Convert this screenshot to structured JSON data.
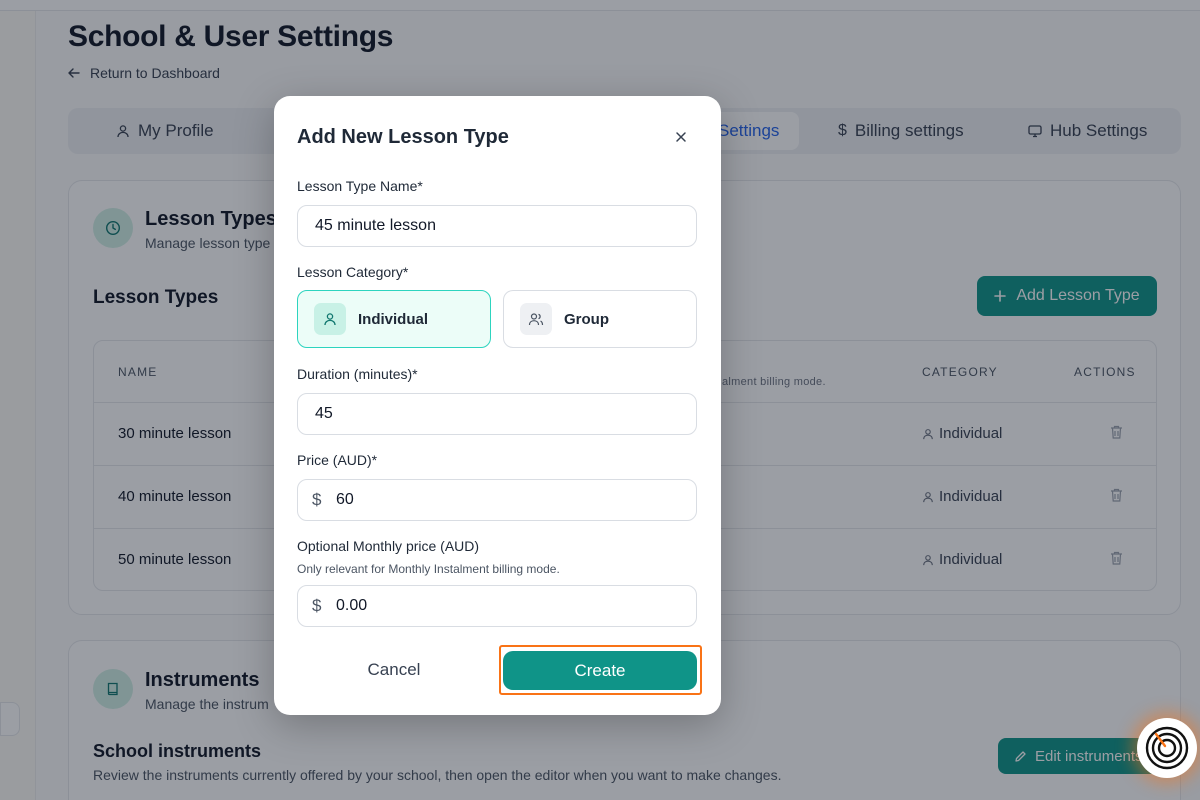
{
  "page": {
    "title": "School & User Settings",
    "back_link": "Return to Dashboard"
  },
  "tabs": [
    {
      "label": "My Profile",
      "icon": "user-icon"
    },
    {
      "label": "Settings",
      "icon": "",
      "active": true
    },
    {
      "label": "Billing settings",
      "icon": "dollar-icon"
    },
    {
      "label": "Hub Settings",
      "icon": "monitor-icon"
    }
  ],
  "lesson_types_section": {
    "title": "Lesson Types",
    "subtitle": "Manage lesson type",
    "list_title": "Lesson Types",
    "add_button": "Add Lesson Type",
    "columns": {
      "name": "NAME",
      "note": "alment billing mode.",
      "category": "CATEGORY",
      "actions": "ACTIONS"
    },
    "rows": [
      {
        "name": "30 minute lesson",
        "category": "Individual"
      },
      {
        "name": "40 minute lesson",
        "category": "Individual"
      },
      {
        "name": "50 minute lesson",
        "category": "Individual"
      }
    ]
  },
  "instruments_section": {
    "title": "Instruments",
    "subtitle": "Manage the instrum",
    "list_title": "School instruments",
    "description": "Review the instruments currently offered by your school, then open the editor when you want to make changes.",
    "edit_button": "Edit instruments"
  },
  "modal": {
    "title": "Add New Lesson Type",
    "name_label": "Lesson Type Name*",
    "name_value": "45 minute lesson",
    "category_label": "Lesson Category*",
    "category_individual": "Individual",
    "category_group": "Group",
    "duration_label": "Duration (minutes)*",
    "duration_value": "45",
    "price_label": "Price (AUD)*",
    "price_symbol": "$",
    "price_value": "60",
    "monthly_label": "Optional Monthly price (AUD)",
    "monthly_hint": "Only relevant for Monthly Instalment billing mode.",
    "monthly_symbol": "$",
    "monthly_value": "0.00",
    "cancel_label": "Cancel",
    "create_label": "Create"
  },
  "colors": {
    "accent": "#0f9488",
    "highlight": "#f97316",
    "active_tab": "#2563eb"
  }
}
